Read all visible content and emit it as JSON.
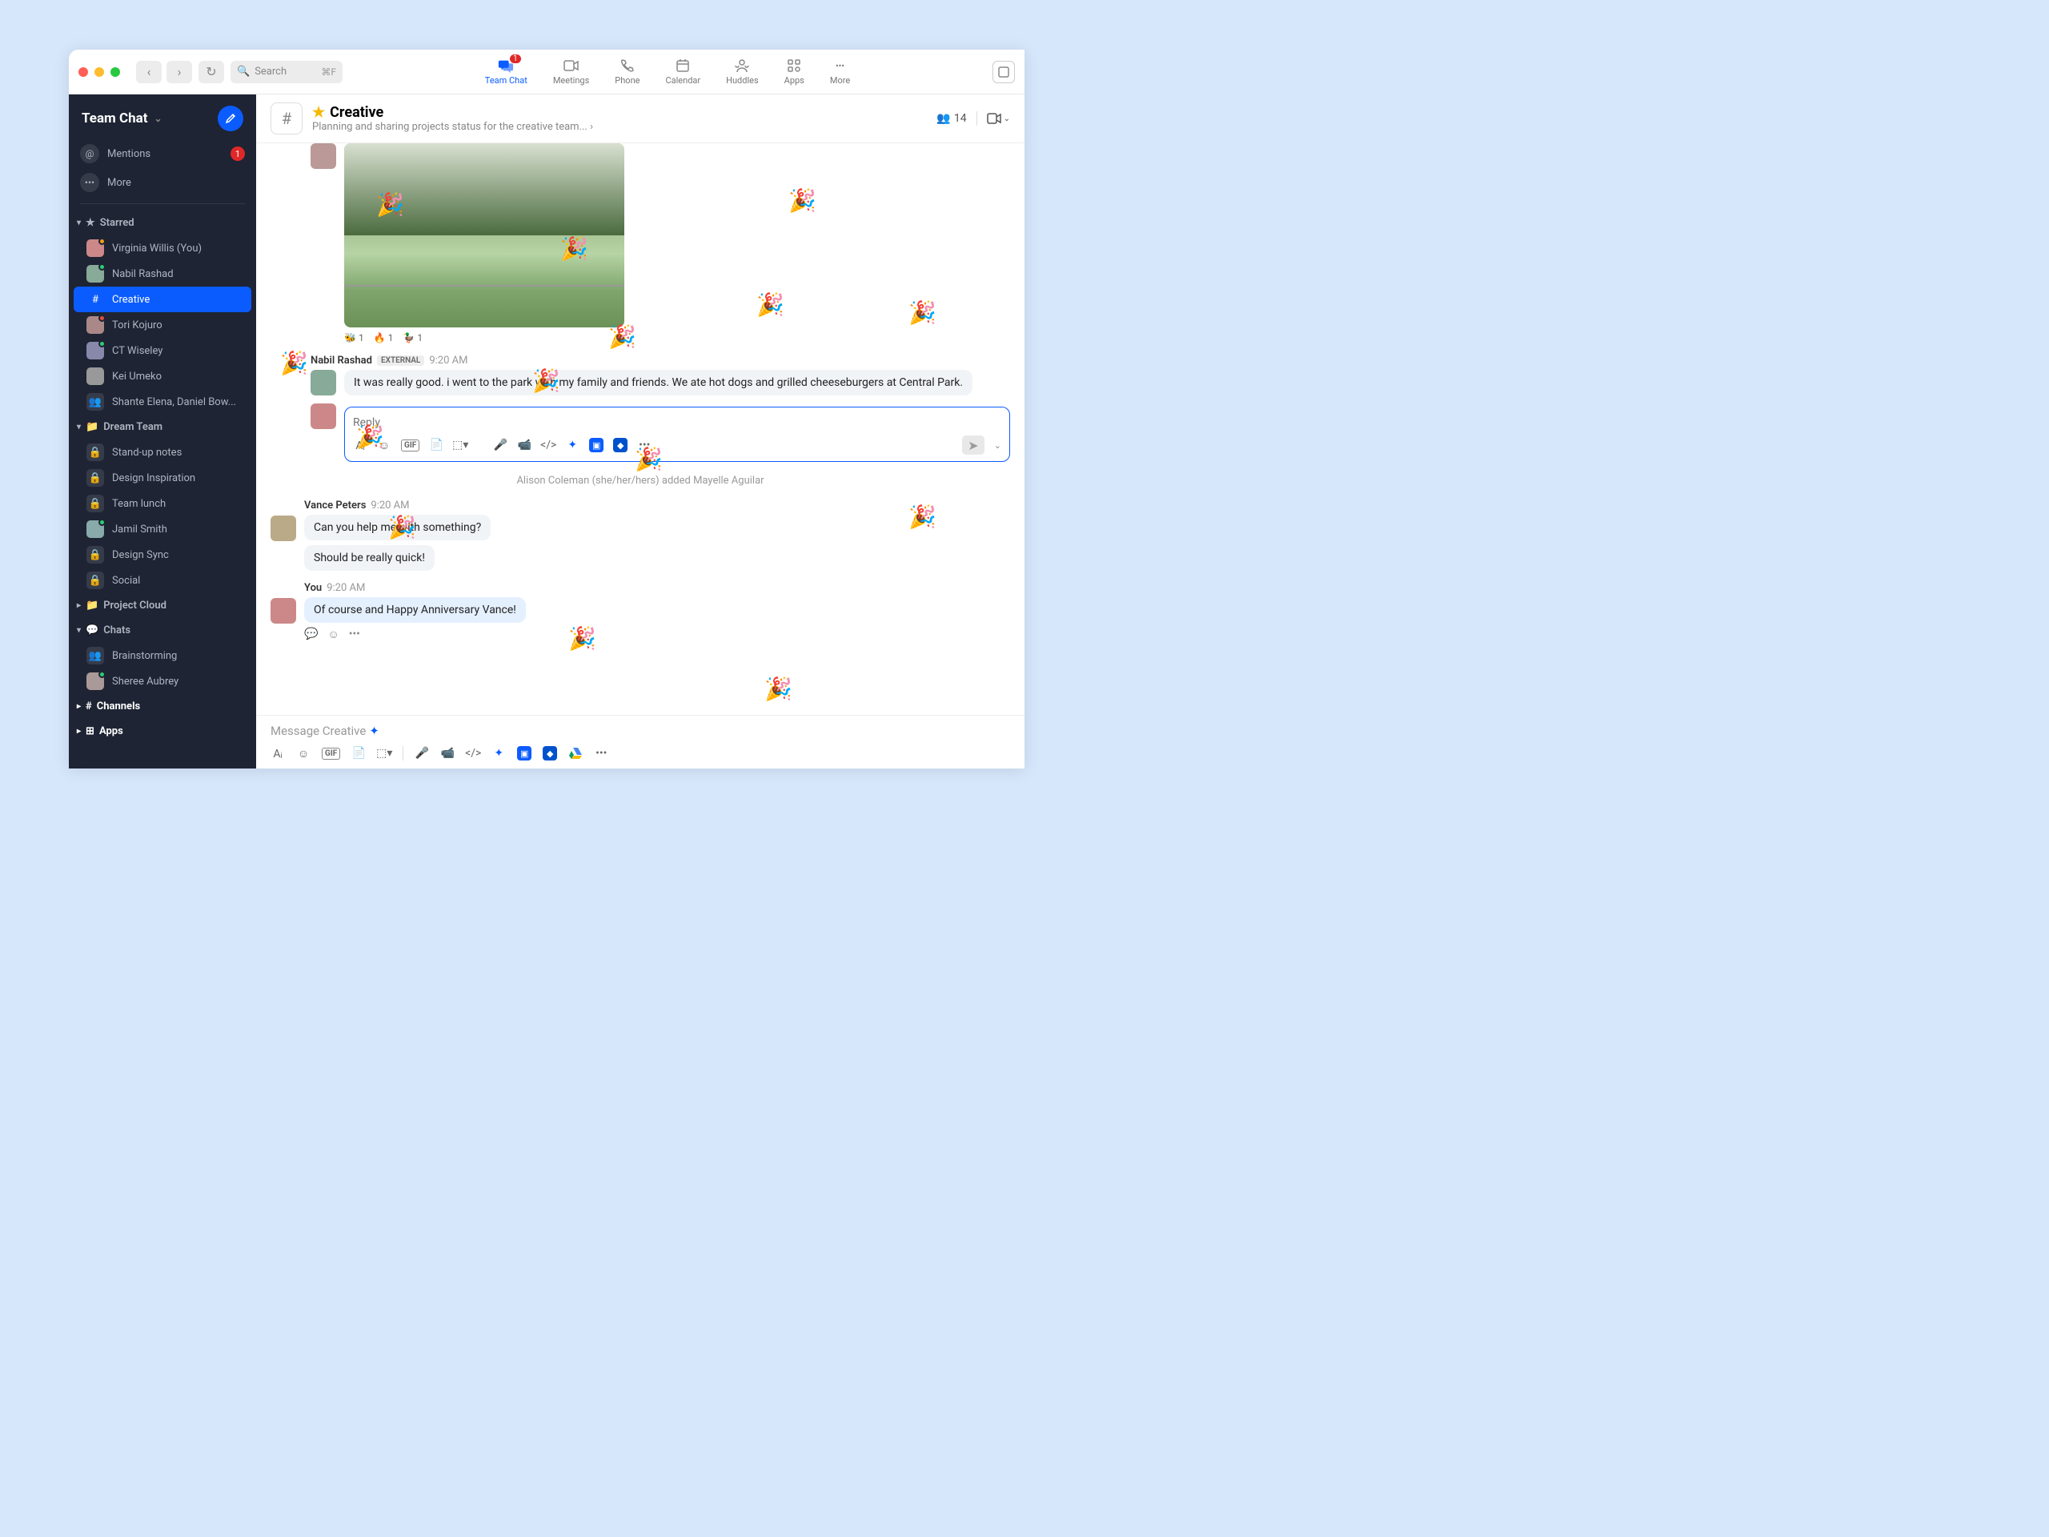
{
  "search": {
    "placeholder": "Search",
    "shortcut": "⌘F"
  },
  "topnav": {
    "items": [
      {
        "label": "Team Chat",
        "badge": "1"
      },
      {
        "label": "Meetings"
      },
      {
        "label": "Phone"
      },
      {
        "label": "Calendar"
      },
      {
        "label": "Huddles"
      },
      {
        "label": "Apps"
      },
      {
        "label": "More"
      }
    ]
  },
  "sidebar": {
    "title": "Team Chat",
    "mentions": {
      "label": "Mentions",
      "badge": "1"
    },
    "more": {
      "label": "More"
    },
    "sections": {
      "starred": {
        "title": "Starred",
        "items": [
          {
            "label": "Virginia Willis (You)",
            "presence": "orange"
          },
          {
            "label": "Nabil Rashad",
            "presence": "green"
          },
          {
            "label": "Creative",
            "type": "channel",
            "selected": true
          },
          {
            "label": "Tori Kojuro",
            "presence": "red"
          },
          {
            "label": "CT Wiseley",
            "presence": "green"
          },
          {
            "label": "Kei Umeko"
          },
          {
            "label": "Shante Elena, Daniel Bow...",
            "type": "group"
          }
        ]
      },
      "dreamteam": {
        "title": "Dream Team",
        "items": [
          {
            "label": "Stand-up notes",
            "type": "lock"
          },
          {
            "label": "Design Inspiration",
            "type": "lock"
          },
          {
            "label": "Team lunch",
            "type": "lock"
          },
          {
            "label": "Jamil Smith",
            "presence": "green"
          },
          {
            "label": "Design Sync",
            "type": "lock"
          },
          {
            "label": "Social",
            "type": "lock"
          }
        ]
      },
      "projectcloud": {
        "title": "Project Cloud"
      },
      "chats": {
        "title": "Chats",
        "items": [
          {
            "label": "Brainstorming",
            "type": "group"
          },
          {
            "label": "Sheree Aubrey",
            "presence": "green"
          }
        ]
      },
      "channels": {
        "title": "Channels"
      },
      "apps": {
        "title": "Apps"
      }
    }
  },
  "channel": {
    "name": "Creative",
    "desc": "Planning and sharing projects status for the creative team...",
    "members": "14"
  },
  "messages": {
    "reactions": [
      {
        "emoji": "🐝",
        "count": "1"
      },
      {
        "emoji": "🔥",
        "count": "1"
      },
      {
        "emoji": "🦆",
        "count": "1"
      }
    ],
    "nabil": {
      "author": "Nabil Rashad",
      "external": "EXTERNAL",
      "time": "9:20 AM",
      "text": "It was really good. i went to the park with my family and friends. We ate hot dogs and grilled cheeseburgers at Central Park."
    },
    "reply_placeholder": "Reply",
    "system": "Alison Coleman (she/her/hers) added Mayelle Aguilar",
    "vance": {
      "author": "Vance Peters",
      "time": "9:20 AM",
      "text1": "Can you help me with something?",
      "text2": "Should be really quick!"
    },
    "you": {
      "author": "You",
      "time": "9:20 AM",
      "text": "Of course and Happy Anniversary Vance!"
    }
  },
  "composer": {
    "placeholder": "Message Creative"
  },
  "toolbar_gif": "GIF"
}
